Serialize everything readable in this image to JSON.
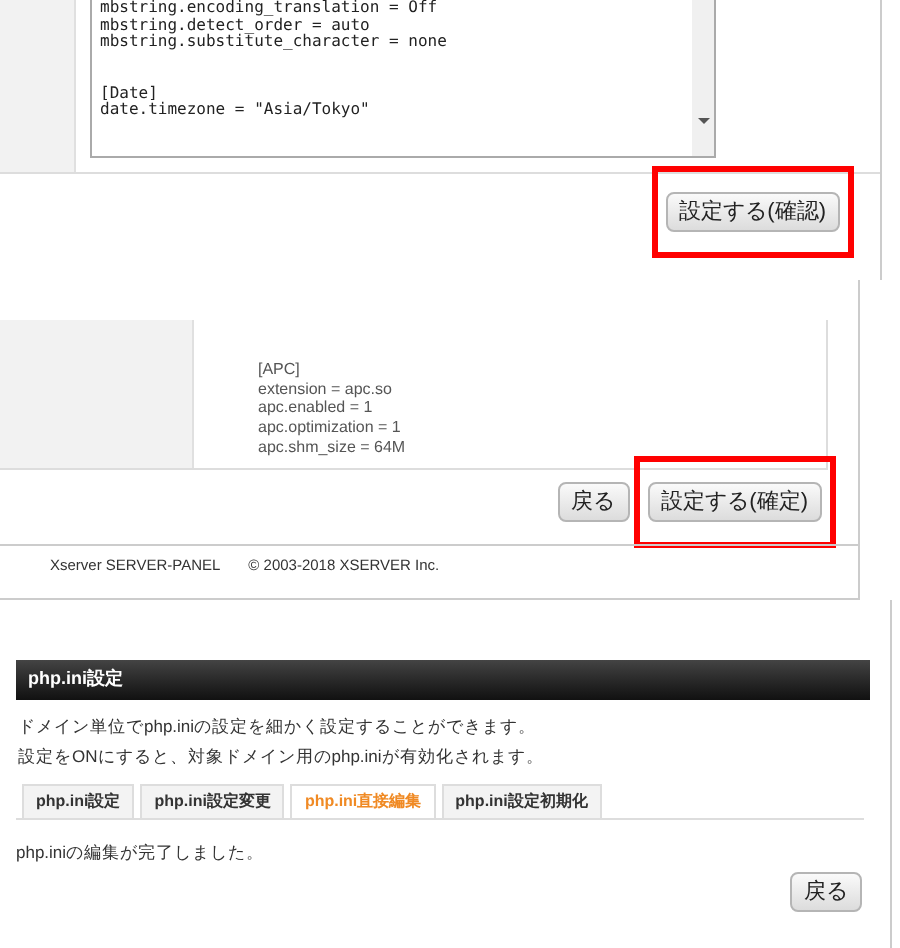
{
  "editor_panel": {
    "code_blocks": [
      [
        "mbstring.encoding_translation = Off",
        "mbstring.detect_order = auto",
        "mbstring.substitute_character = none"
      ],
      [
        "[Date]",
        "date.timezone = \"Asia/Tokyo\""
      ]
    ],
    "buttons": [
      {
        "label": "設定する(確認)",
        "highlighted": true
      }
    ]
  },
  "confirm_panel": {
    "code_lines": [
      "[APC]",
      "extension = apc.so",
      "apc.enabled = 1",
      "apc.optimization = 1",
      "apc.shm_size = 64M"
    ],
    "buttons": [
      {
        "label": "戻る",
        "highlighted": false
      },
      {
        "label": "設定する(確定)",
        "highlighted": true
      }
    ],
    "footer": {
      "brand": "Xserver SERVER-PANEL",
      "copyright": "© 2003-2018 XSERVER Inc."
    }
  },
  "result_panel": {
    "title": "php.ini設定",
    "description": [
      "ドメイン単位でphp.iniの設定を細かく設定することができます。",
      "設定をONにすると、対象ドメイン用のphp.iniが有効化されます。"
    ],
    "tabs": [
      {
        "label": "php.ini設定",
        "selected": false
      },
      {
        "label": "php.ini設定変更",
        "selected": false
      },
      {
        "label": "php.ini直接編集",
        "selected": true
      },
      {
        "label": "php.ini設定初期化",
        "selected": false
      }
    ],
    "message": "php.iniの編集が完了しました。",
    "buttons": [
      {
        "label": "戻る",
        "highlighted": false
      }
    ]
  }
}
